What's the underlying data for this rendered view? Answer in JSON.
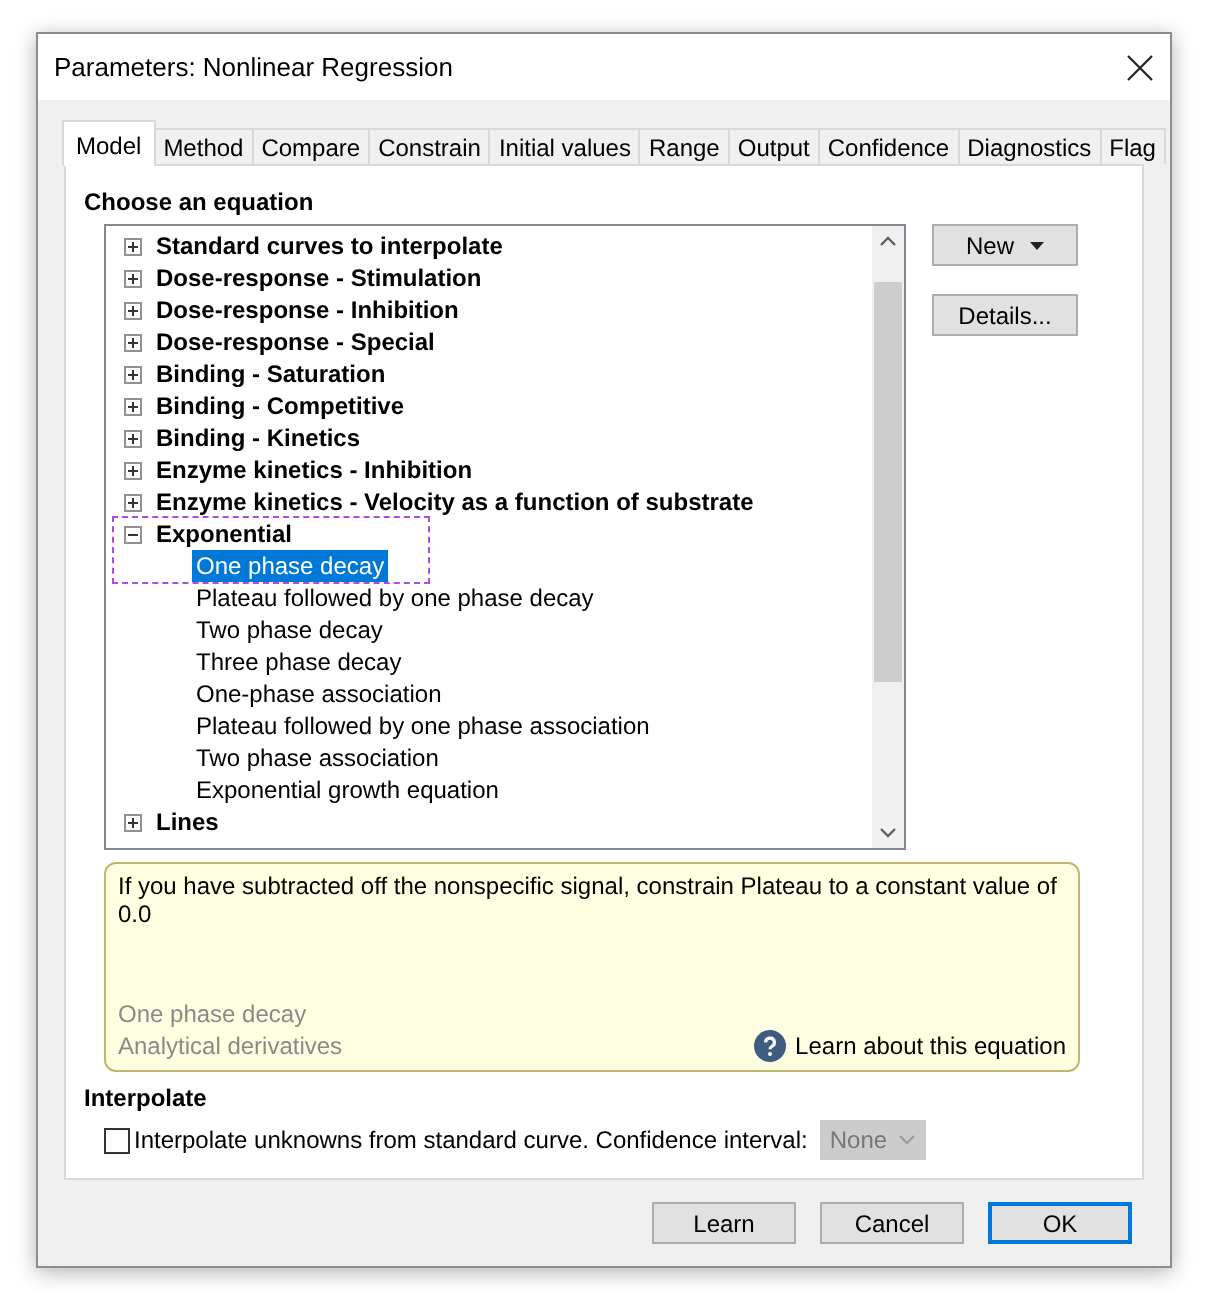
{
  "window": {
    "title": "Parameters: Nonlinear Regression"
  },
  "tabs": [
    {
      "label": "Model",
      "selected": true
    },
    {
      "label": "Method",
      "selected": false
    },
    {
      "label": "Compare",
      "selected": false
    },
    {
      "label": "Constrain",
      "selected": false
    },
    {
      "label": "Initial values",
      "selected": false
    },
    {
      "label": "Range",
      "selected": false
    },
    {
      "label": "Output",
      "selected": false
    },
    {
      "label": "Confidence",
      "selected": false
    },
    {
      "label": "Diagnostics",
      "selected": false
    },
    {
      "label": "Flag",
      "selected": false
    }
  ],
  "equation_section": {
    "heading": "Choose an equation"
  },
  "tree": {
    "items": [
      {
        "label": "Standard curves to interpolate",
        "expanded": false
      },
      {
        "label": "Dose-response - Stimulation",
        "expanded": false
      },
      {
        "label": "Dose-response - Inhibition",
        "expanded": false
      },
      {
        "label": "Dose-response - Special",
        "expanded": false
      },
      {
        "label": "Binding - Saturation",
        "expanded": false
      },
      {
        "label": "Binding - Competitive",
        "expanded": false
      },
      {
        "label": "Binding - Kinetics",
        "expanded": false
      },
      {
        "label": "Enzyme kinetics - Inhibition",
        "expanded": false
      },
      {
        "label": "Enzyme kinetics - Velocity as a function of substrate",
        "expanded": false
      },
      {
        "label": "Exponential",
        "expanded": true,
        "highlighted": true,
        "children": [
          {
            "label": "One phase decay",
            "selected": true
          },
          {
            "label": "Plateau followed by one phase decay",
            "selected": false
          },
          {
            "label": "Two phase decay",
            "selected": false
          },
          {
            "label": "Three phase decay",
            "selected": false
          },
          {
            "label": "One-phase association",
            "selected": false
          },
          {
            "label": "Plateau followed by one phase association",
            "selected": false
          },
          {
            "label": "Two phase association",
            "selected": false
          },
          {
            "label": "Exponential growth equation",
            "selected": false
          }
        ]
      },
      {
        "label": "Lines",
        "expanded": false
      }
    ]
  },
  "side_buttons": [
    {
      "label": "New",
      "kind": "dropdown"
    },
    {
      "label": "Details...",
      "kind": "plain"
    }
  ],
  "info": {
    "text": "If you have subtracted off the nonspecific signal, constrain Plateau to a constant value of 0.0",
    "equation_name": "One phase decay",
    "derivatives": "Analytical derivatives",
    "help_link": "Learn about this equation"
  },
  "interpolate": {
    "heading": "Interpolate",
    "checkbox_label": "Interpolate unknowns from standard curve. Confidence interval:",
    "checked": false,
    "confidence": {
      "value": "None",
      "disabled": true
    }
  },
  "footer_buttons": [
    {
      "label": "Learn",
      "default": false
    },
    {
      "label": "Cancel",
      "default": false
    },
    {
      "label": "OK",
      "default": true
    }
  ]
}
